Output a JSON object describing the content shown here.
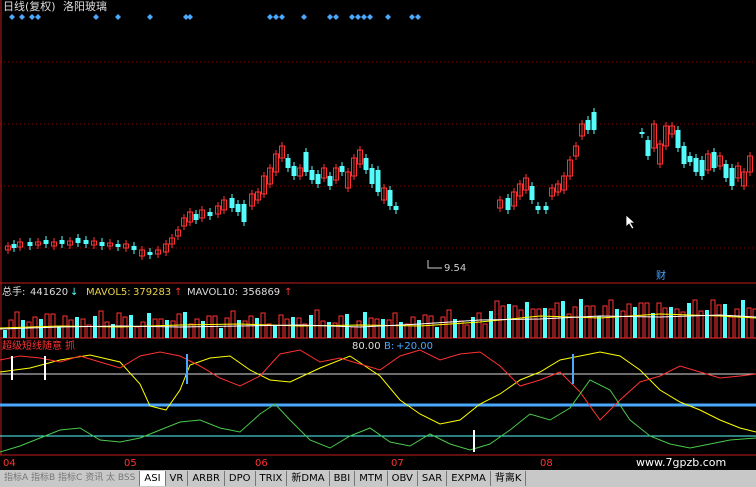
{
  "header": {
    "period": "日线(复权)",
    "stock_name": "洛阳玻璃"
  },
  "colors": {
    "up": "#ff3232",
    "down": "#54fcfc",
    "grid_red": "#8a0000",
    "white": "#ffffff",
    "yellow": "#ffff00",
    "blue": "#4aa8ff",
    "green": "#4ac94a",
    "dark_red": "#c01c1c",
    "label_yellow": "#e8d24a"
  },
  "price_panel": {
    "low_price_label": "9.54",
    "annotation_cai": "财"
  },
  "volume_panel": {
    "total_label": "总手:",
    "total_value": "441620",
    "total_arrow": "↓",
    "mavol5_label": "MAVOL5:",
    "mavol5_value": "379283",
    "mavol5_arrow": "↑",
    "mavol10_label": "MAVOL10:",
    "mavol10_value": "356869",
    "mavol10_arrow": "↑"
  },
  "indicator_panel": {
    "title": "超级短线随意 抓",
    "level_a": "80.00",
    "level_b_label": "B:",
    "level_b": "+20.00"
  },
  "x_axis": {
    "months": [
      "04",
      "05",
      "06",
      "07",
      "08"
    ]
  },
  "watermark": "www.7gpzb.com",
  "bottom_text": "指标A 指标B 指标C 资讯 太 BSS",
  "tabs": [
    "ASI",
    "VR",
    "ARBR",
    "DPO",
    "TRIX",
    "新DMA",
    "BBI",
    "MTM",
    "OBV",
    "SAR",
    "EXPMA",
    "背离K"
  ]
}
